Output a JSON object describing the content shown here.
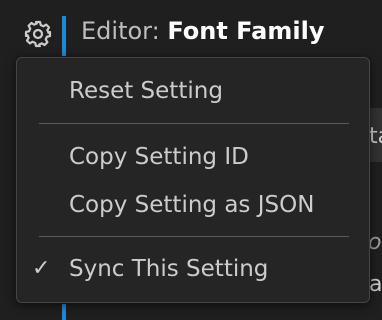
{
  "header": {
    "category": "Editor:",
    "name": "Font Family"
  },
  "background_fragments": {
    "input_text": "ta",
    "text_1": "o",
    "text_2": "a"
  },
  "context_menu": {
    "items": [
      {
        "label": "Reset Setting",
        "checked": false
      },
      {
        "label": "Copy Setting ID",
        "checked": false
      },
      {
        "label": "Copy Setting as JSON",
        "checked": false
      },
      {
        "label": "Sync This Setting",
        "checked": true
      }
    ],
    "check_glyph": "✓"
  },
  "colors": {
    "accent": "#1e8ad6",
    "menu_background": "#252526",
    "page_background": "#1f1f1f"
  },
  "icons": {
    "gear": "gear-icon",
    "check": "check-icon"
  }
}
